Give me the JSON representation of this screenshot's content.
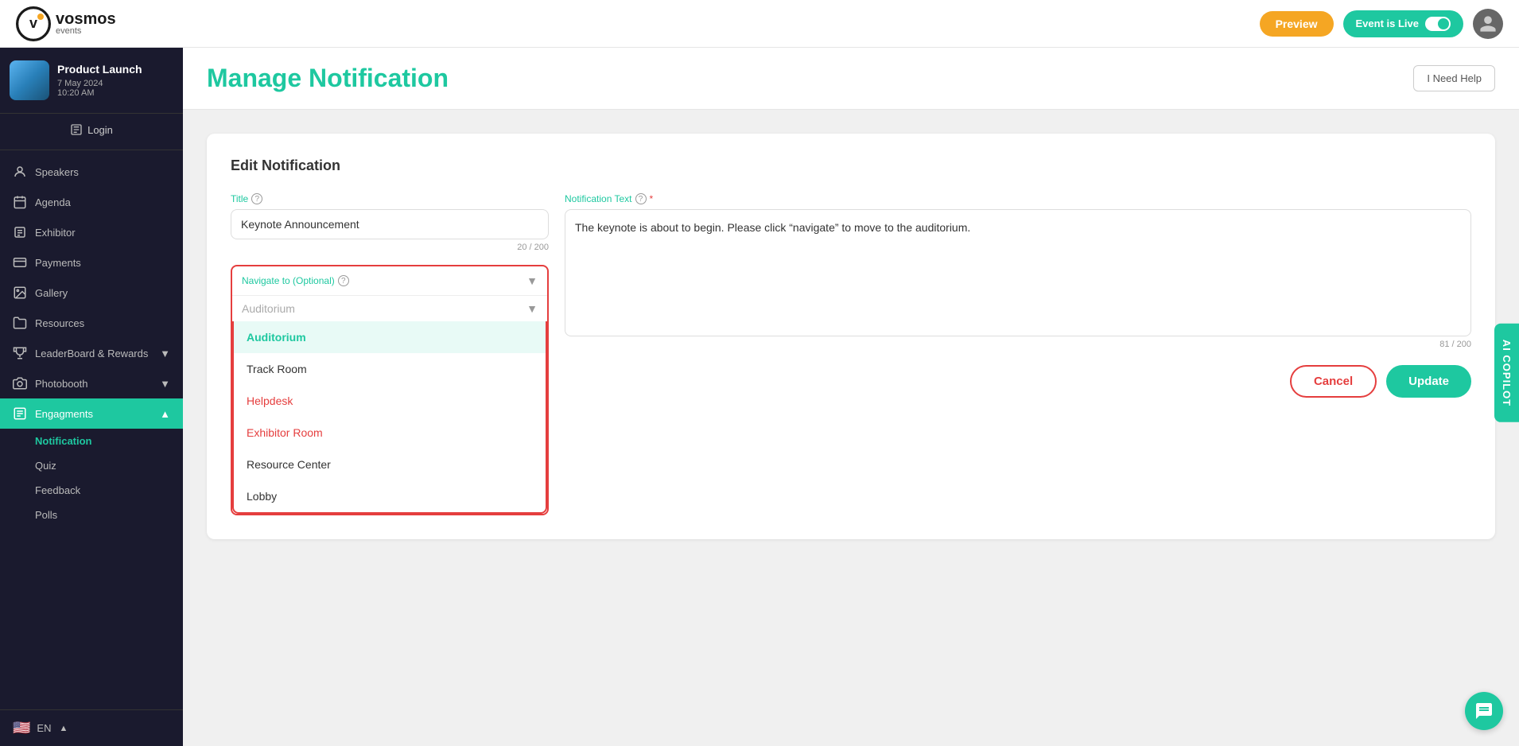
{
  "header": {
    "logo_text": "vosmos",
    "logo_sub": "events",
    "preview_label": "Preview",
    "live_label": "Event is Live",
    "help_label": "I Need Help"
  },
  "sidebar": {
    "event": {
      "name": "Product Launch",
      "date": "7 May 2024",
      "time": "10:20 AM"
    },
    "login_label": "Login",
    "nav_items": [
      {
        "id": "speakers",
        "label": "Speakers",
        "icon": "person-icon"
      },
      {
        "id": "agenda",
        "label": "Agenda",
        "icon": "calendar-icon"
      },
      {
        "id": "exhibitor",
        "label": "Exhibitor",
        "icon": "badge-icon"
      },
      {
        "id": "payments",
        "label": "Payments",
        "icon": "payment-icon"
      },
      {
        "id": "gallery",
        "label": "Gallery",
        "icon": "image-icon"
      },
      {
        "id": "resources",
        "label": "Resources",
        "icon": "folder-icon"
      },
      {
        "id": "leaderboard",
        "label": "LeaderBoard & Rewards",
        "icon": "trophy-icon",
        "has_arrow": true
      },
      {
        "id": "photobooth",
        "label": "Photobooth",
        "icon": "camera-icon",
        "has_arrow": true
      },
      {
        "id": "engagements",
        "label": "Engagments",
        "icon": "engage-icon",
        "active": true,
        "has_arrow": true
      }
    ],
    "sub_items": [
      {
        "id": "notification",
        "label": "Notification",
        "active": true
      },
      {
        "id": "quiz",
        "label": "Quiz"
      },
      {
        "id": "feedback",
        "label": "Feedback"
      },
      {
        "id": "polls",
        "label": "Polls"
      }
    ],
    "language": "EN"
  },
  "page": {
    "title": "Manage Notification",
    "edit_section_title": "Edit Notification",
    "title_field": {
      "label": "Title",
      "value": "Keynote Announcement",
      "char_count": "20 / 200"
    },
    "navigate_field": {
      "label": "Navigate to (Optional)",
      "placeholder": "Auditorium",
      "selected": "Auditorium",
      "options": [
        {
          "id": "auditorium",
          "label": "Auditorium",
          "selected": true
        },
        {
          "id": "track-room",
          "label": "Track Room"
        },
        {
          "id": "helpdesk",
          "label": "Helpdesk",
          "style": "red"
        },
        {
          "id": "exhibitor-room",
          "label": "Exhibitor Room",
          "style": "red"
        },
        {
          "id": "resource-center",
          "label": "Resource Center"
        },
        {
          "id": "lobby",
          "label": "Lobby"
        }
      ]
    },
    "notification_text_field": {
      "label": "Notification Text",
      "required": true,
      "value": "The keynote is about to begin. Please click “navigate” to move to the auditorium.",
      "char_count": "81 / 200"
    },
    "cancel_label": "Cancel",
    "update_label": "Update",
    "ai_copilot_label": "AI COPILOT"
  }
}
